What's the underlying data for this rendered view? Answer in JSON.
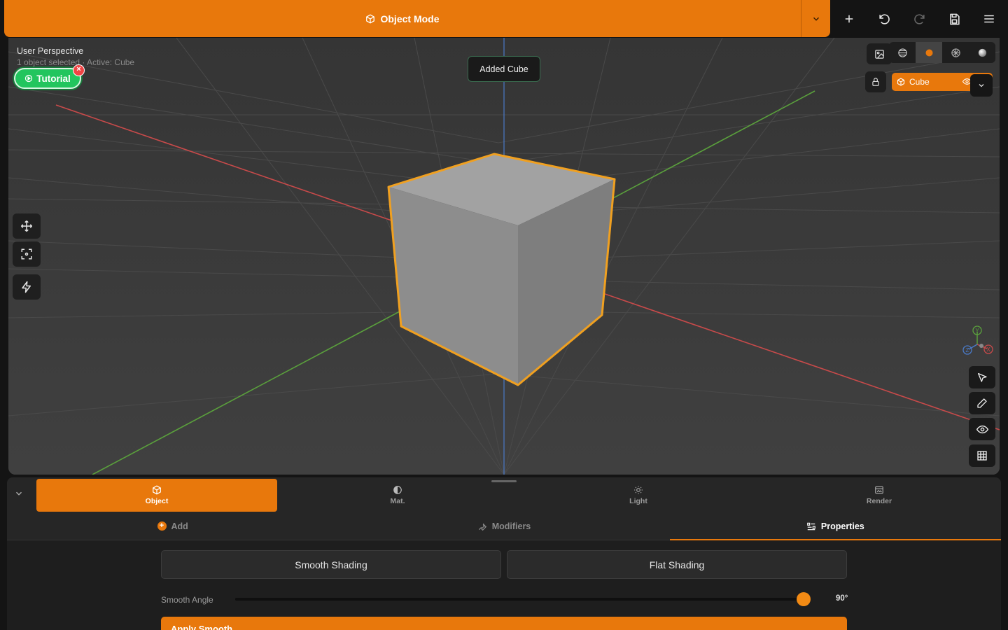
{
  "topbar": {
    "mode_label": "Object Mode",
    "icons": [
      "cube-icon",
      "chevron-down-icon",
      "plus-icon",
      "undo-icon",
      "redo-icon",
      "save-icon",
      "menu-icon"
    ]
  },
  "viewport": {
    "title": "User Perspective",
    "subtitle": "1 object selected · Active: Cube",
    "tutorial_label": "Tutorial",
    "toast": "Added Cube",
    "active_object": "Cube",
    "gizmo_axes": [
      "Y",
      "Z",
      "X"
    ]
  },
  "panel": {
    "tabs": [
      {
        "label": "Object",
        "icon": "cube-icon",
        "active": true
      },
      {
        "label": "Mat.",
        "icon": "contrast-icon",
        "active": false
      },
      {
        "label": "Light",
        "icon": "sun-icon",
        "active": false
      },
      {
        "label": "Render",
        "icon": "image-icon",
        "active": false
      }
    ],
    "subtabs": [
      {
        "label": "Add",
        "active": false
      },
      {
        "label": "Modifiers",
        "active": false
      },
      {
        "label": "Properties",
        "active": true
      }
    ],
    "smooth_shading_label": "Smooth Shading",
    "flat_shading_label": "Flat Shading",
    "smooth_angle_label": "Smooth Angle",
    "smooth_angle_value": "90°",
    "smooth_angle_fraction": 1.0,
    "apply_label": "Apply Smooth"
  },
  "colors": {
    "accent": "#e8780c",
    "success": "#22c55e",
    "danger": "#ef4444",
    "axis_x": "#c84a4a",
    "axis_y": "#5aa03c",
    "axis_z": "#4a7ac8"
  }
}
